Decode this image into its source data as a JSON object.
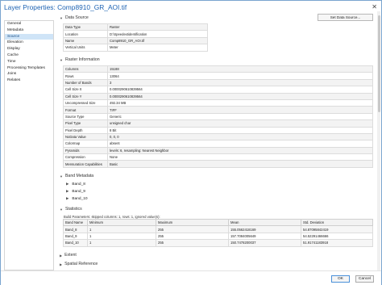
{
  "window": {
    "title": "Layer Properties: Comp8910_GR_AOI.tif",
    "close_glyph": "✕"
  },
  "sidebar": {
    "items": [
      {
        "label": "General"
      },
      {
        "label": "Metadata"
      },
      {
        "label": "Source",
        "active": true
      },
      {
        "label": "Elevation"
      },
      {
        "label": "Display"
      },
      {
        "label": "Cache"
      },
      {
        "label": "Time"
      },
      {
        "label": "Processing Templates"
      },
      {
        "label": "Joins"
      },
      {
        "label": "Relates"
      }
    ]
  },
  "data_source": {
    "heading": "Data Source",
    "button": "Set Data Source...",
    "rows": [
      {
        "key": "Data Type",
        "value": "Raster"
      },
      {
        "key": "Location",
        "value": "D:\\Speedextidentification"
      },
      {
        "key": "Name",
        "value": "Comp8910_GR_AOI.tif"
      },
      {
        "key": "Vertical Units",
        "value": "Meter"
      }
    ]
  },
  "raster_information": {
    "heading": "Raster Information",
    "rows": [
      {
        "key": "Columns",
        "value": "15188"
      },
      {
        "key": "Rows",
        "value": "13064"
      },
      {
        "key": "Number of Bands",
        "value": "3"
      },
      {
        "key": "Cell Size X",
        "value": "0.0000290610839564"
      },
      {
        "key": "Cell Size Y",
        "value": "0.0000290610839564"
      },
      {
        "key": "Uncompressed Size",
        "value": "492.34 MB"
      },
      {
        "key": "Format",
        "value": "TIFF"
      },
      {
        "key": "Source Type",
        "value": "Generic"
      },
      {
        "key": "Pixel Type",
        "value": "unsigned char"
      },
      {
        "key": "Pixel Depth",
        "value": "8 Bit"
      },
      {
        "key": "NoData Value",
        "value": "0, 0, 0"
      },
      {
        "key": "Colormap",
        "value": "absent"
      },
      {
        "key": "Pyramids",
        "value": "levels: 6, resampling: Nearest Neighbor"
      },
      {
        "key": "Compression",
        "value": "None"
      },
      {
        "key": "Mensuration Capabilities",
        "value": "Basic"
      }
    ]
  },
  "band_metadata": {
    "heading": "Band Metadata",
    "bands": [
      {
        "label": "Band_8"
      },
      {
        "label": "Band_9"
      },
      {
        "label": "Band_10"
      }
    ]
  },
  "statistics": {
    "heading": "Statistics",
    "note": "Build Parameters: skipped columns: 1, rows: 1, ignored value(s):",
    "columns": [
      "Band Name",
      "Minimum",
      "Maximum",
      "Mean",
      "Std. Deviation"
    ],
    "rows": [
      [
        "Band_8",
        "1",
        "255",
        "155.0562418169",
        "54.87095842419"
      ],
      [
        "Band_9",
        "1",
        "255",
        "157.7084005649",
        "54.52291466666"
      ],
      [
        "Band_10",
        "1",
        "255",
        "150.7478200037",
        "51.91741183918"
      ]
    ]
  },
  "extent": {
    "heading": "Extent"
  },
  "spatial_reference": {
    "heading": "Spatial Reference"
  },
  "footer": {
    "ok": "OK",
    "cancel": "Cancel"
  }
}
